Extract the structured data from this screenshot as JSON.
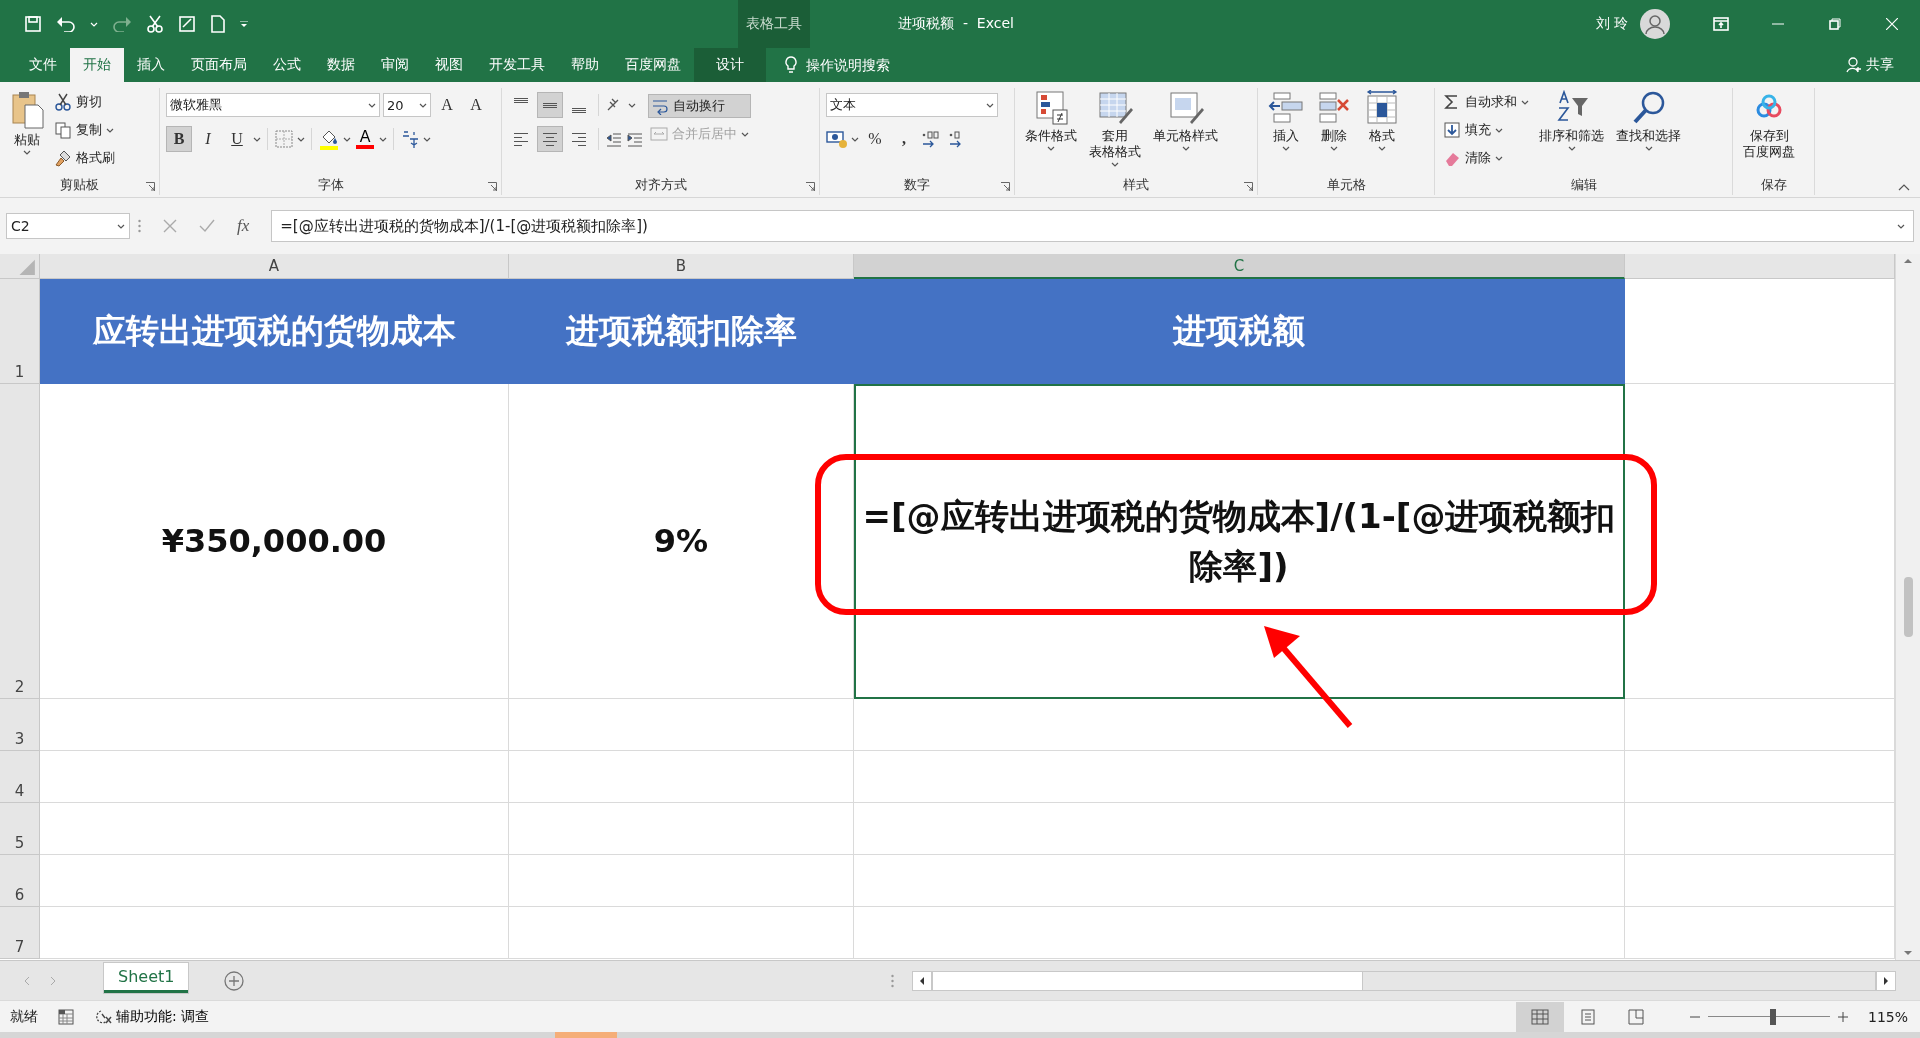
{
  "window": {
    "title": "进项税额  -  Excel",
    "context_group": "表格工具",
    "user": "刘 玲"
  },
  "menu_tabs": [
    {
      "label": "文件",
      "selected": false,
      "kind": "normal"
    },
    {
      "label": "开始",
      "selected": true,
      "kind": "normal"
    },
    {
      "label": "插入",
      "selected": false,
      "kind": "normal"
    },
    {
      "label": "页面布局",
      "selected": false,
      "kind": "normal"
    },
    {
      "label": "公式",
      "selected": false,
      "kind": "normal"
    },
    {
      "label": "数据",
      "selected": false,
      "kind": "normal"
    },
    {
      "label": "审阅",
      "selected": false,
      "kind": "normal"
    },
    {
      "label": "视图",
      "selected": false,
      "kind": "normal"
    },
    {
      "label": "开发工具",
      "selected": false,
      "kind": "normal"
    },
    {
      "label": "帮助",
      "selected": false,
      "kind": "normal"
    },
    {
      "label": "百度网盘",
      "selected": false,
      "kind": "normal"
    },
    {
      "label": "设计",
      "selected": false,
      "kind": "context"
    }
  ],
  "tell_me": {
    "placeholder": "操作说明搜索"
  },
  "share": "共享",
  "clipboard": {
    "label": "剪贴板",
    "paste": "粘贴",
    "cut": "剪切",
    "copy": "复制",
    "format_painter": "格式刷"
  },
  "font": {
    "label": "字体",
    "font_name": "微软雅黑",
    "font_size": "20",
    "grow": "A",
    "shrink": "A",
    "font_color": "A",
    "styles": [
      {
        "label": "B",
        "selected": true
      },
      {
        "label": "I",
        "selected": false
      },
      {
        "label": "U",
        "selected": false
      }
    ]
  },
  "alignment": {
    "label": "对齐方式",
    "vertical": [
      {
        "selected": false
      },
      {
        "selected": true
      },
      {
        "selected": false
      }
    ],
    "horizontal": [
      {
        "selected": false
      },
      {
        "selected": true
      },
      {
        "selected": false
      }
    ],
    "wrap_text": {
      "label": "自动换行",
      "selected": true
    },
    "merge": {
      "label": "合并后居中",
      "disabled": true
    }
  },
  "number": {
    "label": "数字",
    "format": "文本",
    "percent": "%",
    "comma": ","
  },
  "styles": {
    "label": "样式",
    "buttons": [
      [
        "条件格式"
      ],
      [
        "套用",
        "表格格式"
      ],
      [
        "单元格样式"
      ]
    ]
  },
  "cells": {
    "label": "单元格",
    "buttons": [
      [
        "插入"
      ],
      [
        "删除"
      ],
      [
        "格式"
      ]
    ]
  },
  "editing": {
    "label": "编辑",
    "small": [
      "自动求和",
      "填充",
      "清除"
    ],
    "large": [
      [
        "排序和筛选"
      ],
      [
        "查找和选择"
      ]
    ]
  },
  "save": {
    "label": "保存",
    "button": [
      "保存到",
      "百度网盘"
    ]
  },
  "formula_bar": {
    "name_box": "C2",
    "fx": "fx",
    "formula": "=[@应转出进项税的货物成本]/(1-[@进项税额扣除率])"
  },
  "sheet": {
    "columns": [
      {
        "label": "A",
        "selected": false
      },
      {
        "label": "B",
        "selected": false
      },
      {
        "label": "C",
        "selected": true
      }
    ],
    "rows": [
      {
        "label": "1",
        "kind": "header",
        "cells": [
          {
            "text": "应转出进项税的货物成本",
            "selected": false
          },
          {
            "text": "进项税额扣除率",
            "selected": false
          },
          {
            "text": "进项税额",
            "selected": false
          }
        ]
      },
      {
        "label": "2",
        "kind": "data",
        "cells": [
          {
            "text": "¥350,000.00",
            "selected": false
          },
          {
            "text": "9%",
            "selected": false
          },
          {
            "text": "=[@应转出进项税的货物成本]/(1-[@进项税额扣除率])",
            "selected": true
          }
        ]
      },
      {
        "label": "3",
        "kind": "empty"
      },
      {
        "label": "4",
        "kind": "empty"
      },
      {
        "label": "5",
        "kind": "empty"
      },
      {
        "label": "6",
        "kind": "empty"
      },
      {
        "label": "7",
        "kind": "empty"
      }
    ]
  },
  "sheet_tabs": [
    {
      "label": "Sheet1",
      "selected": true
    }
  ],
  "status_bar": {
    "ready": "就绪",
    "accessibility": "辅助功能: 调查",
    "views": [
      {
        "selected": true
      },
      {
        "selected": false
      },
      {
        "selected": false
      }
    ],
    "zoom": {
      "level": 0.53,
      "reading": "115%"
    }
  }
}
